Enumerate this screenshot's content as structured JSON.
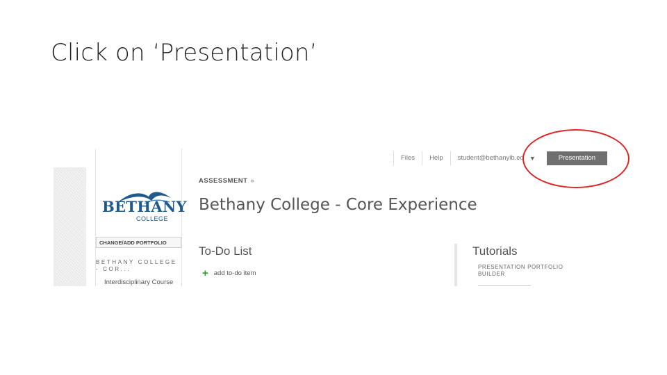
{
  "slide": {
    "title": "Click on ‘Presentation’"
  },
  "screenshot": {
    "nav": {
      "files": "Files",
      "help": "Help",
      "user": "student@bethanylb.ed",
      "presentation": "Presentation"
    },
    "sidebar": {
      "logo_text": "BETHANY",
      "logo_sub": "COLLEGE",
      "change_portfolio": "CHANGE/ADD PORTFOLIO",
      "portfolio_heading": "BETHANY COLLEGE - COR...",
      "item": "Interdisciplinary Course"
    },
    "main": {
      "breadcrumb": "ASSESSMENT",
      "breadcrumb_sep": "»",
      "page_title": "Bethany College - Core Experience",
      "todo_title": "To-Do List",
      "todo_add": "add to-do item"
    },
    "tutorials": {
      "title": "Tutorials",
      "item": "PRESENTATION PORTFOLIO BUILDER"
    }
  },
  "colors": {
    "highlight": "#e02424",
    "brand": "#1e5a8e",
    "add": "#2c9a2c"
  }
}
